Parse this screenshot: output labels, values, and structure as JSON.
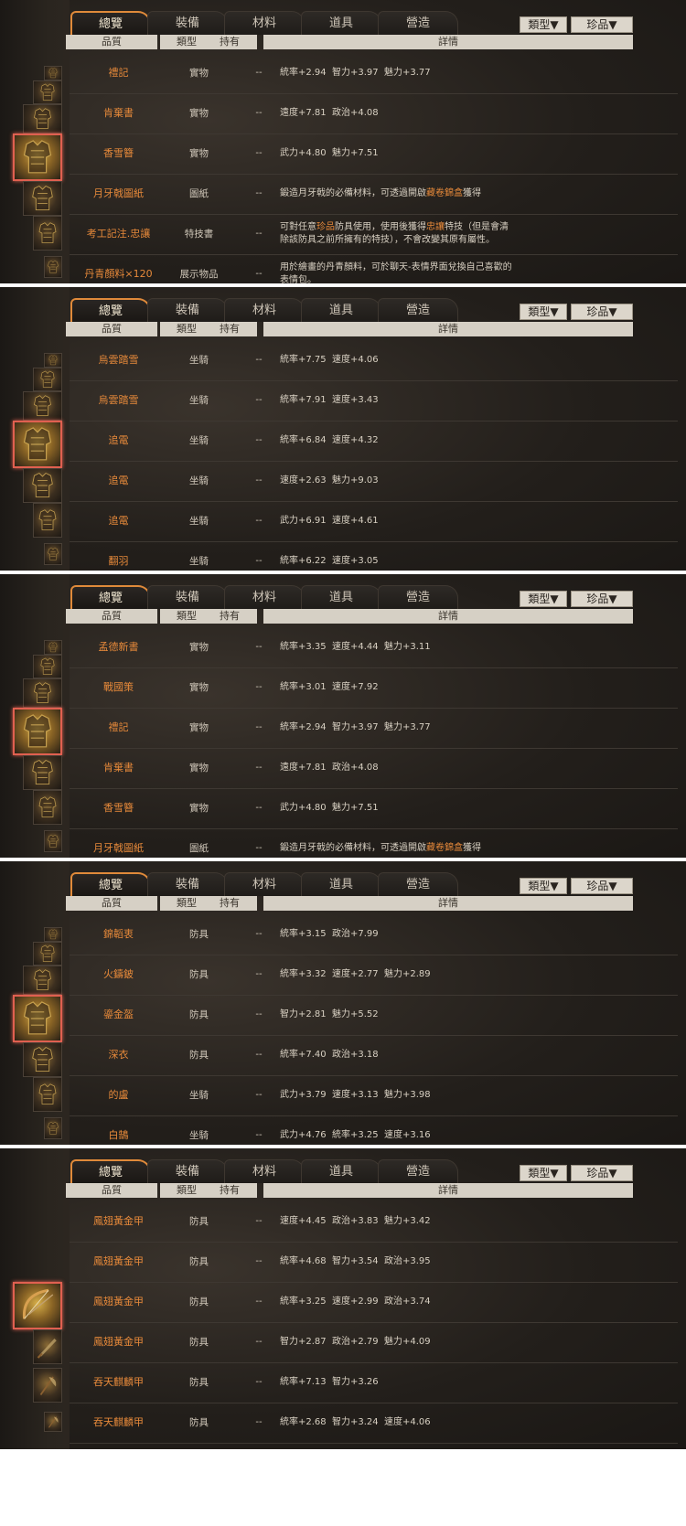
{
  "tabs": [
    "總覽",
    "裝備",
    "材料",
    "道具",
    "營造"
  ],
  "dropdowns": {
    "type_label": "類型▼",
    "rarity_label": "珍品▼"
  },
  "columns": {
    "quality": "品質",
    "type": "類型",
    "owned": "持有",
    "details": "詳情"
  },
  "colors": {
    "accent": "#e6893a",
    "selected_border": "#e06050",
    "header_bg": "#d6d0c5"
  },
  "panels": [
    {
      "thumb_style": "armor",
      "rows": [
        {
          "name": "禮記",
          "type": "實物",
          "owned": "--",
          "details": [
            "統率+2.94  智力+3.97  魅力+3.77"
          ]
        },
        {
          "name": "肯棄書",
          "type": "實物",
          "owned": "--",
          "details": [
            "遠度+7.81  政治+4.08"
          ]
        },
        {
          "name": "香雪簪",
          "type": "實物",
          "owned": "--",
          "details": [
            "武力+4.80  魅力+7.51"
          ]
        },
        {
          "name": "月牙戟圖紙",
          "type": "圖紙",
          "owned": "--",
          "details": [
            "鍛造月牙戟的必備材料，可透過開啟",
            "藏卷錦盒",
            "獲得"
          ]
        },
        {
          "name": "考工記注.忠讓",
          "type": "特技書",
          "owned": "--",
          "details": [
            "可對任意",
            "珍品",
            "防具使用，使用後獲得",
            "忠讓",
            "特技（但是會清",
            "除該防具之前所擁有的特技），不會改變其原有屬性。"
          ]
        },
        {
          "name": "丹青顏料×120",
          "type": "展示物品",
          "owned": "--",
          "details": [
            "用於繪畫的丹青顏料，可於聊天-表情界面兌換自己喜歡的",
            "表情包。"
          ]
        }
      ]
    },
    {
      "thumb_style": "armor",
      "rows": [
        {
          "name": "烏雲踏雪",
          "type": "坐騎",
          "owned": "--",
          "details": [
            "統率+7.75  速度+4.06"
          ]
        },
        {
          "name": "烏雲踏雪",
          "type": "坐騎",
          "owned": "--",
          "details": [
            "統率+7.91  速度+3.43"
          ]
        },
        {
          "name": "追電",
          "type": "坐騎",
          "owned": "--",
          "details": [
            "統率+6.84  速度+4.32"
          ]
        },
        {
          "name": "追電",
          "type": "坐騎",
          "owned": "--",
          "details": [
            "速度+2.63  魅力+9.03"
          ]
        },
        {
          "name": "追電",
          "type": "坐騎",
          "owned": "--",
          "details": [
            "武力+6.91  速度+4.61"
          ]
        },
        {
          "name": "翻羽",
          "type": "坐騎",
          "owned": "--",
          "details": [
            "統率+6.22  速度+3.05"
          ]
        }
      ]
    },
    {
      "thumb_style": "armor",
      "rows": [
        {
          "name": "孟德新書",
          "type": "實物",
          "owned": "--",
          "details": [
            "統率+3.35  速度+4.44  魅力+3.11"
          ]
        },
        {
          "name": "戰國策",
          "type": "實物",
          "owned": "--",
          "details": [
            "統率+3.01  速度+7.92"
          ]
        },
        {
          "name": "禮記",
          "type": "實物",
          "owned": "--",
          "details": [
            "統率+2.94  智力+3.97  魅力+3.77"
          ]
        },
        {
          "name": "肯棄書",
          "type": "實物",
          "owned": "--",
          "details": [
            "遠度+7.81  政治+4.08"
          ]
        },
        {
          "name": "香雪簪",
          "type": "實物",
          "owned": "--",
          "details": [
            "武力+4.80  魅力+7.51"
          ]
        },
        {
          "name": "月牙戟圖紙",
          "type": "圖紙",
          "owned": "--",
          "details": [
            "鍛造月牙戟的必備材料，可透過開啟",
            "藏卷錦盒",
            "獲得"
          ]
        }
      ]
    },
    {
      "thumb_style": "armor",
      "rows": [
        {
          "name": "錦韜衷",
          "type": "防具",
          "owned": "--",
          "details": [
            "統率+3.15  政治+7.99"
          ]
        },
        {
          "name": "火鑄鈹",
          "type": "防具",
          "owned": "--",
          "details": [
            "統率+3.32  速度+2.77  魅力+2.89"
          ]
        },
        {
          "name": "鎏金盔",
          "type": "防具",
          "owned": "--",
          "details": [
            "智力+2.81  魅力+5.52"
          ]
        },
        {
          "name": "深衣",
          "type": "防具",
          "owned": "--",
          "details": [
            "統率+7.40  政治+3.18"
          ]
        },
        {
          "name": "的盧",
          "type": "坐騎",
          "owned": "--",
          "details": [
            "武力+3.79  速度+3.13  魅力+3.98"
          ]
        },
        {
          "name": "白鵠",
          "type": "坐騎",
          "owned": "--",
          "details": [
            "武力+4.76  統率+3.25  速度+3.16"
          ]
        }
      ]
    },
    {
      "thumb_style": "weapon",
      "rows": [
        {
          "name": "鳳翅黃金甲",
          "type": "防具",
          "owned": "--",
          "details": [
            "速度+4.45  政治+3.83  魅力+3.42"
          ]
        },
        {
          "name": "鳳翅黃金甲",
          "type": "防具",
          "owned": "--",
          "details": [
            "統率+4.68  智力+3.54  政治+3.95"
          ]
        },
        {
          "name": "鳳翅黃金甲",
          "type": "防具",
          "owned": "--",
          "details": [
            "統率+3.25  速度+2.99  政治+3.74"
          ]
        },
        {
          "name": "鳳翅黃金甲",
          "type": "防具",
          "owned": "--",
          "details": [
            "智力+2.87  政治+2.79  魅力+4.09"
          ]
        },
        {
          "name": "吞天麒麟甲",
          "type": "防具",
          "owned": "--",
          "details": [
            "統率+7.13  智力+3.26"
          ]
        },
        {
          "name": "吞天麒麟甲",
          "type": "防具",
          "owned": "--",
          "details": [
            "統率+2.68  智力+3.24  速度+4.06"
          ]
        }
      ]
    }
  ]
}
